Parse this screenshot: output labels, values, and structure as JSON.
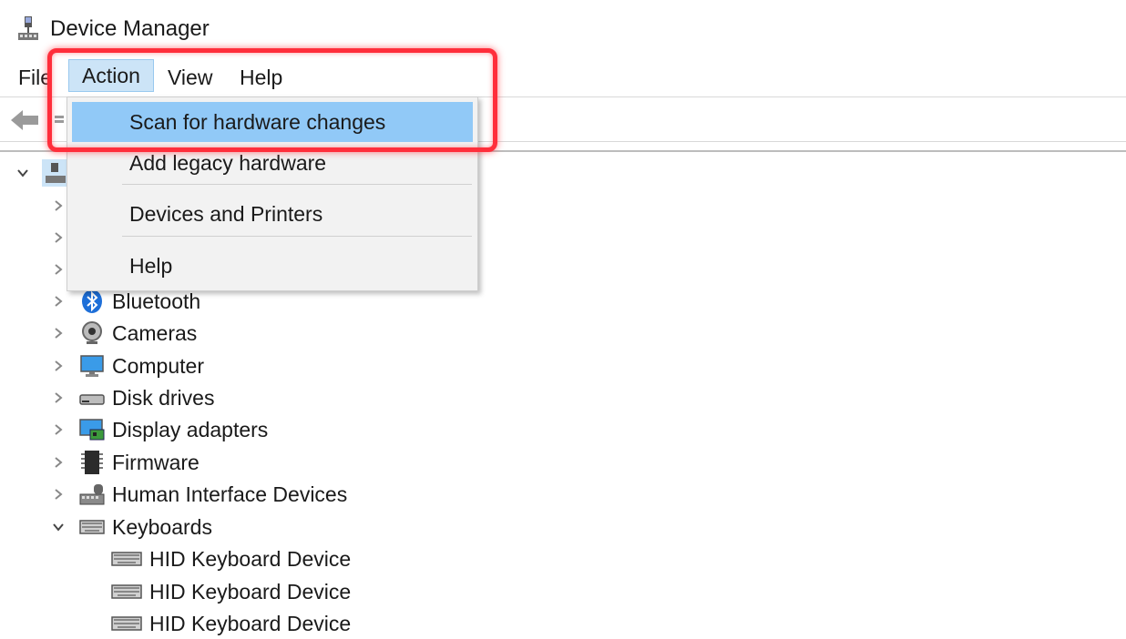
{
  "window": {
    "title": "Device Manager"
  },
  "menubar": {
    "items": [
      {
        "label": "File"
      },
      {
        "label": "Action"
      },
      {
        "label": "View"
      },
      {
        "label": "Help"
      }
    ]
  },
  "dropdown": {
    "items": [
      {
        "label": "Scan for hardware changes"
      },
      {
        "label": "Add legacy hardware"
      },
      {
        "label": "Devices and Printers"
      },
      {
        "label": "Help"
      }
    ]
  },
  "tree": {
    "categories": [
      {
        "label": "Bluetooth",
        "icon": "bluetooth-icon"
      },
      {
        "label": "Cameras",
        "icon": "camera-icon"
      },
      {
        "label": "Computer",
        "icon": "computer-icon"
      },
      {
        "label": "Disk drives",
        "icon": "disk-drive-icon"
      },
      {
        "label": "Display adapters",
        "icon": "display-adapter-icon"
      },
      {
        "label": "Firmware",
        "icon": "firmware-icon"
      },
      {
        "label": "Human Interface Devices",
        "icon": "hid-icon"
      },
      {
        "label": "Keyboards",
        "icon": "keyboard-icon"
      }
    ],
    "keyboard_children": [
      {
        "label": "HID Keyboard Device"
      },
      {
        "label": "HID Keyboard Device"
      },
      {
        "label": "HID Keyboard Device"
      }
    ]
  },
  "colors": {
    "menu_active_bg": "#cce4f7",
    "dropdown_highlight": "#91c9f7",
    "annotation_red": "#ff2e3b"
  }
}
